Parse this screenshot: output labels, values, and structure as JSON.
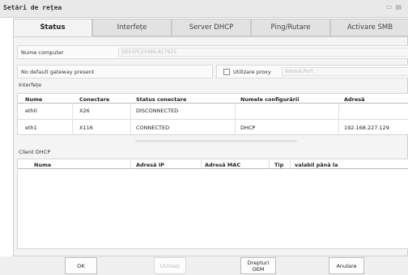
{
  "window": {
    "title": "Setări de rețea"
  },
  "tabs": [
    {
      "label": "Status",
      "active": true
    },
    {
      "label": "Interfețe"
    },
    {
      "label": "Server DHCP"
    },
    {
      "label": "Ping/Rutare"
    },
    {
      "label": "Activare SMB"
    }
  ],
  "computer": {
    "label": "Nume computer",
    "value": "DE01PC23486-817625"
  },
  "gateway": {
    "label": "No default gateway present"
  },
  "proxy": {
    "label": "Utilizare proxy",
    "placeholder": "Adresă:Port"
  },
  "interfaces": {
    "section_label": "Interfețe",
    "columns": [
      "Nume",
      "Conectare",
      "Status conectare",
      "Numele configurării",
      "Adresă"
    ],
    "rows": [
      [
        "eth0",
        "X26",
        "DISCONNECTED",
        "",
        ""
      ],
      [
        "eth1",
        "X116",
        "CONNECTED",
        "DHCP",
        "192.168.227.129"
      ]
    ]
  },
  "dhcp": {
    "section_label": "Client DHCP",
    "columns": [
      "Nume",
      "Adresă IP",
      "Adresă MAC",
      "Tip",
      "valabil până la"
    ]
  },
  "buttons": {
    "ok": "OK",
    "apply": "Utilizați",
    "oem_line1": "Drepturi",
    "oem_line2": "OEM",
    "cancel": "Anulare"
  },
  "colors": {
    "panel": "#f4f4f4",
    "tab_active": "#f4f4f4",
    "tab_inactive": "#e2e2e2"
  }
}
